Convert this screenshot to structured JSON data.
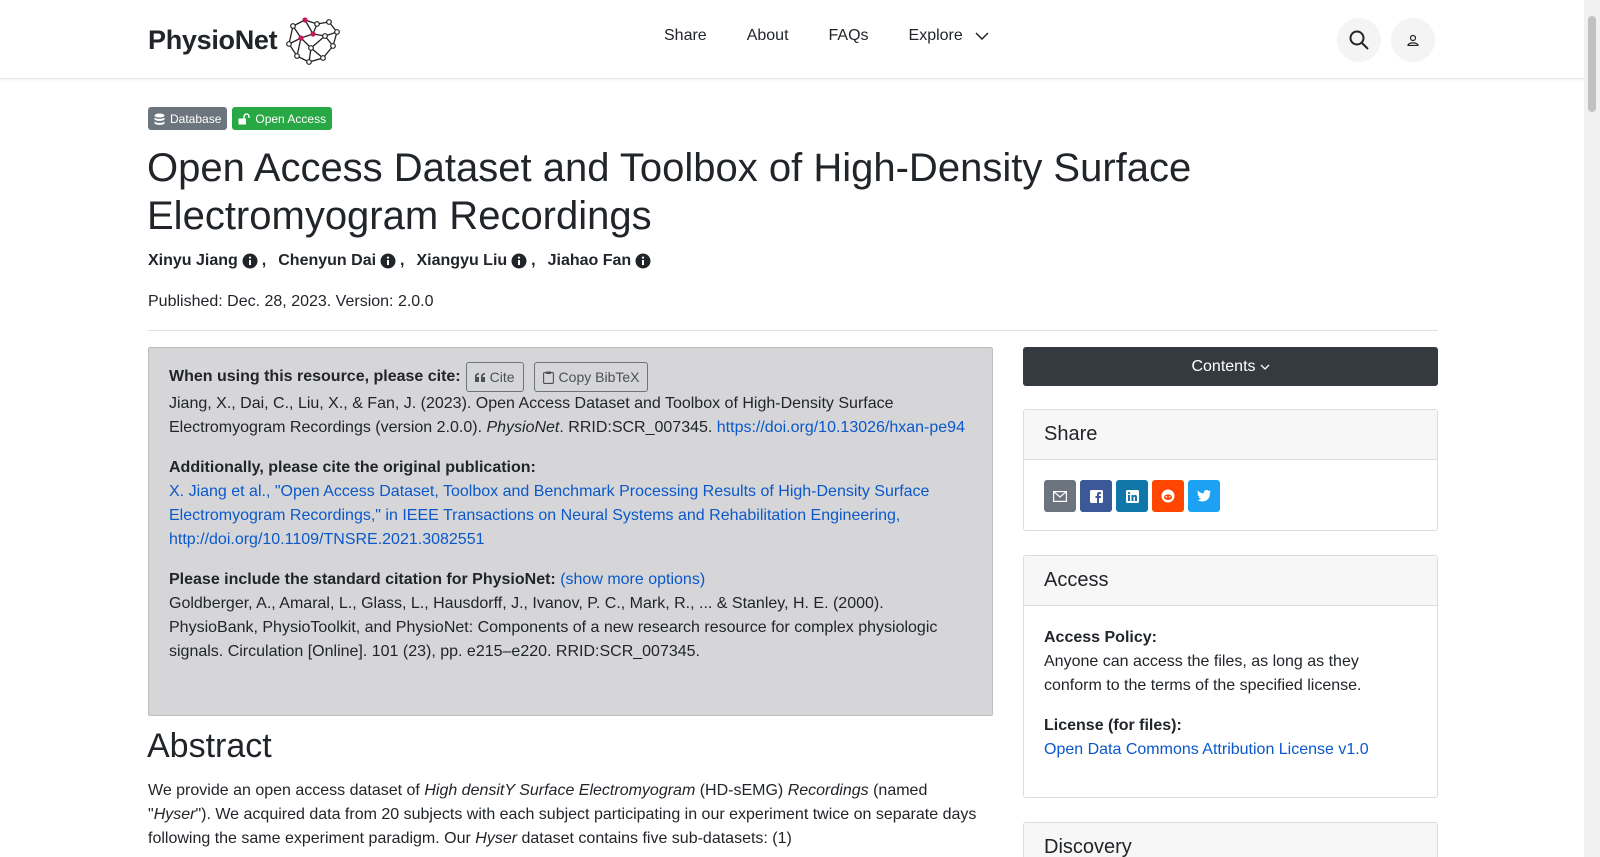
{
  "nav": {
    "brand": "PhysioNet",
    "links": [
      "Share",
      "About",
      "FAQs",
      "Explore"
    ]
  },
  "badges": {
    "database": "Database",
    "open_access": "Open Access"
  },
  "page": {
    "title": "Open Access Dataset and Toolbox of High-Density Surface Electromyogram Recordings",
    "authors": [
      "Xinyu Jiang",
      "Chenyun Dai",
      "Xiangyu Liu",
      "Jiahao Fan"
    ],
    "author_separator": ",",
    "published": "Published: Dec. 28, 2023. Version: 2.0.0"
  },
  "cite": {
    "heading": "When using this resource, please cite:",
    "cite_button": "Cite",
    "bibtex_button": "Copy BibTeX",
    "citation_pre": "Jiang, X., Dai, C., Liu, X., & Fan, J. (2023). Open Access Dataset and Toolbox of High-Density Surface Electromyogram Recordings (version 2.0.0). ",
    "citation_journal": "PhysioNet",
    "citation_post": ". RRID:SCR_007345. ",
    "citation_doi": "https://doi.org/10.13026/hxan-pe94",
    "original_heading": "Additionally, please cite the original publication:",
    "original_link": "X. Jiang et al., \"Open Access Dataset, Toolbox and Benchmark Processing Results of High-Density Surface Electromyogram Recordings,\" in IEEE Transactions on Neural Systems and Rehabilitation Engineering, http://doi.org/10.1109/TNSRE.2021.3082551",
    "standard_heading": "Please include the standard citation for PhysioNet:",
    "show_more": "(show more options)",
    "standard_text": "Goldberger, A., Amaral, L., Glass, L., Hausdorff, J., Ivanov, P. C., Mark, R., ... & Stanley, H. E. (2000). PhysioBank, PhysioToolkit, and PhysioNet: Components of a new research resource for complex physiologic signals. Circulation [Online]. 101 (23), pp. e215–e220. RRID:SCR_007345."
  },
  "abstract": {
    "heading": "Abstract",
    "p1": "We provide an open access dataset of ",
    "em1": "High densitY Surface Electromyogram",
    "p2": " (HD-sEMG) ",
    "em2": "Recordings",
    "p3": " (named \"",
    "em3": "Hyser",
    "p4": "\"). We acquired data from 20 subjects with each subject participating in our experiment twice on separate days following the same experiment paradigm. Our ",
    "em4": "Hyser",
    "p5": " dataset contains five sub-datasets: (1)"
  },
  "sidebar": {
    "contents": "Contents",
    "share_title": "Share",
    "share_icons": [
      "email-icon",
      "facebook-icon",
      "linkedin-icon",
      "reddit-icon",
      "twitter-icon"
    ],
    "share_colors": [
      "#6c757d",
      "#3b5998",
      "#0e76a8",
      "#ff4500",
      "#1da1f2"
    ],
    "access_title": "Access",
    "access_policy_label": "Access Policy:",
    "access_policy_text": "Anyone can access the files, as long as they conform to the terms of the specified license.",
    "license_label": "License (for files):",
    "license_link": "Open Data Commons Attribution License v1.0",
    "discovery_title": "Discovery"
  }
}
